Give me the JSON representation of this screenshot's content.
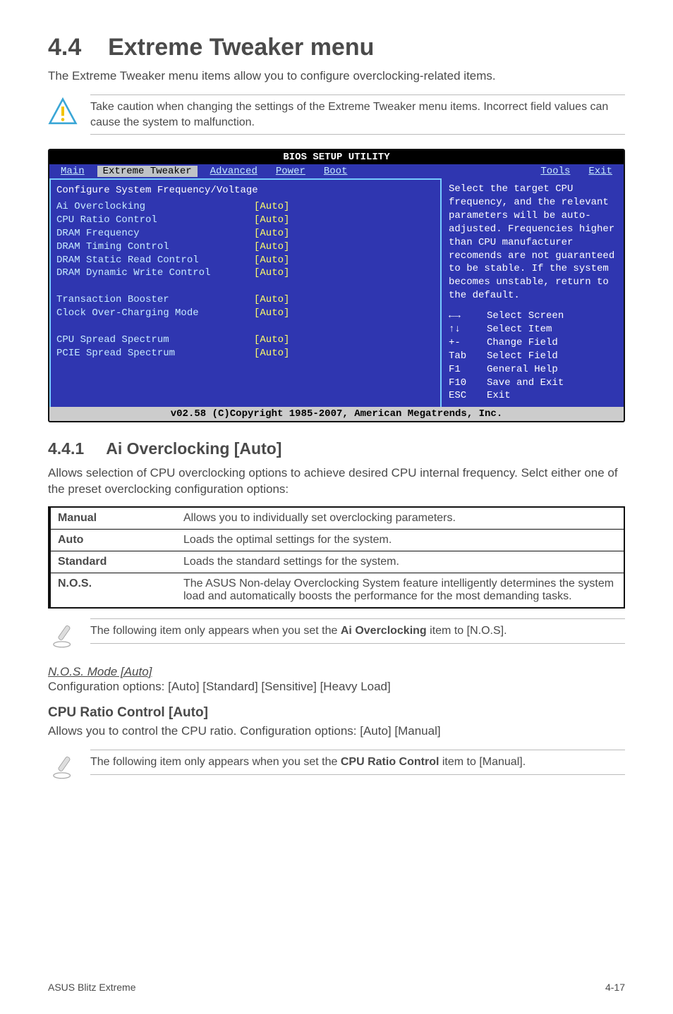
{
  "heading": {
    "num": "4.4",
    "title": "Extreme Tweaker menu"
  },
  "intro": "The Extreme Tweaker menu items allow you to configure overclocking-related items.",
  "caution": "Take caution when changing the settings of the Extreme Tweaker menu items. Incorrect field values can cause the system to malfunction.",
  "bios": {
    "title": "BIOS SETUP UTILITY",
    "tabs": [
      "Main",
      "Extreme Tweaker",
      "Advanced",
      "Power",
      "Boot",
      "Tools",
      "Exit"
    ],
    "selected_tab": "Extreme Tweaker",
    "subhead": "Configure System Frequency/Voltage",
    "rows": [
      {
        "label": "Ai Overclocking",
        "value": "[Auto]"
      },
      {
        "label": "CPU Ratio Control",
        "value": "[Auto]"
      },
      {
        "label": "DRAM Frequency",
        "value": "[Auto]"
      },
      {
        "label": "DRAM Timing Control",
        "value": "[Auto]"
      },
      {
        "label": "DRAM Static Read Control",
        "value": "[Auto]"
      },
      {
        "label": "DRAM Dynamic Write Control",
        "value": "[Auto]"
      },
      {
        "label": "",
        "value": ""
      },
      {
        "label": "Transaction Booster",
        "value": "[Auto]"
      },
      {
        "label": "Clock Over-Charging Mode",
        "value": "[Auto]"
      },
      {
        "label": "",
        "value": ""
      },
      {
        "label": "CPU Spread Spectrum",
        "value": "[Auto]"
      },
      {
        "label": "PCIE Spread Spectrum",
        "value": "[Auto]"
      }
    ],
    "help": "Select the target CPU frequency, and the relevant parameters will be auto-adjusted. Frequencies higher than CPU manufacturer recomends are not guaranteed to be stable. If the system becomes unstable, return to the default.",
    "keys": [
      {
        "k": "←→",
        "d": "Select Screen"
      },
      {
        "k": "↑↓",
        "d": "Select Item"
      },
      {
        "k": "+-",
        "d": "Change Field"
      },
      {
        "k": "Tab",
        "d": "Select Field"
      },
      {
        "k": "F1",
        "d": "General Help"
      },
      {
        "k": "F10",
        "d": "Save and Exit"
      },
      {
        "k": "ESC",
        "d": "Exit"
      }
    ],
    "footer": "v02.58 (C)Copyright 1985-2007, American Megatrends, Inc."
  },
  "sec441": {
    "num": "4.4.1",
    "title": "Ai Overclocking [Auto]",
    "para": "Allows selection of CPU overclocking options to achieve desired CPU internal frequency. Selct either one of the preset overclocking configuration options:",
    "rows": [
      {
        "name": "Manual",
        "desc": "Allows you to individually set overclocking parameters."
      },
      {
        "name": "Auto",
        "desc": "Loads the optimal settings for the system."
      },
      {
        "name": "Standard",
        "desc": "Loads the standard settings for the system."
      },
      {
        "name": "N.O.S.",
        "desc": "The ASUS Non-delay Overclocking System feature intelligently determines the system load and automatically boosts the performance for the most demanding tasks."
      }
    ]
  },
  "note1_prefix": "The following item only appears when you set the ",
  "note1_bold": "Ai Overclocking",
  "note1_suffix": " item to [N.O.S].",
  "nos_mode_title": "N.O.S. Mode [Auto]",
  "nos_mode_opts": "Configuration options: [Auto] [Standard] [Sensitive] [Heavy Load]",
  "cpu_ratio_title": "CPU Ratio Control [Auto]",
  "cpu_ratio_para": "Allows you to control the CPU ratio. Configuration options: [Auto] [Manual]",
  "note2_prefix": "The following item only appears when you set the ",
  "note2_bold": "CPU Ratio Control",
  "note2_suffix": " item to [Manual].",
  "footer_left": "ASUS Blitz Extreme",
  "footer_right": "4-17"
}
